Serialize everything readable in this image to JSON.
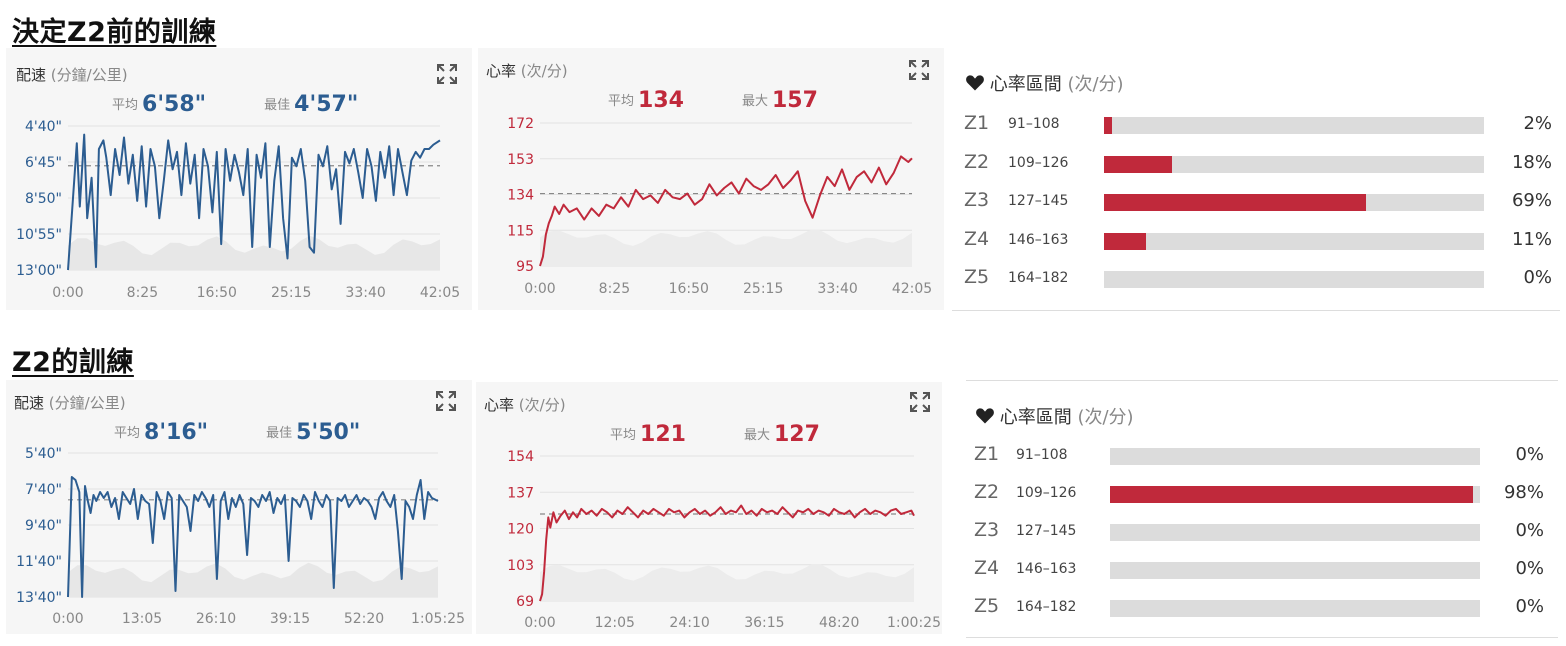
{
  "sections": [
    {
      "title": "決定Z2前的訓練",
      "pace": {
        "label": "配速",
        "unit": "(分鐘/公里)",
        "avg_label": "平均",
        "avg": "6'58\"",
        "best_label": "最佳",
        "best": "4'57\""
      },
      "hr": {
        "label": "心率",
        "unit": "(次/分)",
        "avg_label": "平均",
        "avg": "134",
        "max_label": "最大",
        "max": "157"
      },
      "zones": {
        "icon": "heart-icon",
        "label": "心率區間",
        "unit": "(次/分)",
        "items": [
          {
            "name": "Z1",
            "range": "91–108",
            "pct_text": "2%",
            "pct": 2
          },
          {
            "name": "Z2",
            "range": "109–126",
            "pct_text": "18%",
            "pct": 18
          },
          {
            "name": "Z3",
            "range": "127–145",
            "pct_text": "69%",
            "pct": 69
          },
          {
            "name": "Z4",
            "range": "146–163",
            "pct_text": "11%",
            "pct": 11
          },
          {
            "name": "Z5",
            "range": "164–182",
            "pct_text": "0%",
            "pct": 0
          }
        ]
      }
    },
    {
      "title": "Z2的訓練",
      "pace": {
        "label": "配速",
        "unit": "(分鐘/公里)",
        "avg_label": "平均",
        "avg": "8'16\"",
        "best_label": "最佳",
        "best": "5'50\""
      },
      "hr": {
        "label": "心率",
        "unit": "(次/分)",
        "avg_label": "平均",
        "avg": "121",
        "max_label": "最大",
        "max": "127"
      },
      "zones": {
        "icon": "heart-icon",
        "label": "心率區間",
        "unit": "(次/分)",
        "items": [
          {
            "name": "Z1",
            "range": "91–108",
            "pct_text": "0%",
            "pct": 0
          },
          {
            "name": "Z2",
            "range": "109–126",
            "pct_text": "98%",
            "pct": 98
          },
          {
            "name": "Z3",
            "range": "127–145",
            "pct_text": "0%",
            "pct": 0
          },
          {
            "name": "Z4",
            "range": "146–163",
            "pct_text": "0%",
            "pct": 0
          },
          {
            "name": "Z5",
            "range": "164–182",
            "pct_text": "0%",
            "pct": 0
          }
        ]
      }
    }
  ],
  "chart_data": [
    {
      "type": "line",
      "id": "pace1",
      "color": "#2c5d91",
      "yticks": [
        "4'40\"",
        "6'45\"",
        "8'50\"",
        "10'55\"",
        "13'00\""
      ],
      "ylim_seconds": [
        280,
        780
      ],
      "inverted": true,
      "xticks": [
        "0:00",
        "8:25",
        "16:50",
        "25:15",
        "33:40",
        "42:05"
      ],
      "xlim_seconds": [
        0,
        2525
      ],
      "avg_seconds": 418,
      "series": [
        {
          "x": [
            0,
            60,
            80,
            110,
            130,
            160,
            190,
            210,
            240,
            260,
            290,
            320,
            350,
            380,
            410,
            440,
            470,
            500,
            530,
            560,
            590,
            620,
            650,
            680,
            710,
            740,
            770,
            800,
            830,
            860,
            890,
            920,
            950,
            980,
            1010,
            1040,
            1070,
            1100,
            1130,
            1160,
            1190,
            1220,
            1250,
            1280,
            1310,
            1340,
            1370,
            1400,
            1430,
            1460,
            1490,
            1520,
            1550,
            1580,
            1610,
            1640,
            1670,
            1700,
            1730,
            1760,
            1790,
            1820,
            1850,
            1880,
            1910,
            1940,
            1970,
            2000,
            2030,
            2060,
            2090,
            2120,
            2150,
            2180,
            2210,
            2240,
            2270,
            2300,
            2330,
            2360,
            2390,
            2420,
            2450,
            2480,
            2525
          ],
          "y": [
            780,
            340,
            560,
            310,
            600,
            460,
            770,
            360,
            330,
            390,
            520,
            360,
            450,
            320,
            480,
            380,
            540,
            350,
            560,
            360,
            420,
            600,
            470,
            330,
            430,
            370,
            520,
            340,
            480,
            380,
            600,
            360,
            420,
            580,
            370,
            690,
            360,
            470,
            380,
            440,
            520,
            360,
            700,
            380,
            460,
            340,
            700,
            470,
            350,
            600,
            740,
            390,
            420,
            360,
            470,
            700,
            720,
            380,
            420,
            350,
            500,
            430,
            620,
            370,
            410,
            360,
            440,
            530,
            360,
            420,
            540,
            370,
            460,
            350,
            520,
            360,
            440,
            520,
            400,
            370,
            390,
            360,
            360,
            345,
            330
          ]
        }
      ]
    },
    {
      "type": "line",
      "id": "hr1",
      "color": "#c0293b",
      "yticks": [
        "172",
        "153",
        "134",
        "115",
        "95"
      ],
      "ylim": [
        95,
        172
      ],
      "xticks": [
        "0:00",
        "8:25",
        "16:50",
        "25:15",
        "33:40",
        "42:05"
      ],
      "xlim_seconds": [
        0,
        2525
      ],
      "avg": 134,
      "series": [
        {
          "x": [
            0,
            20,
            40,
            60,
            80,
            100,
            130,
            160,
            200,
            250,
            300,
            350,
            400,
            450,
            500,
            550,
            600,
            650,
            700,
            750,
            800,
            850,
            900,
            950,
            1000,
            1050,
            1100,
            1150,
            1200,
            1250,
            1300,
            1350,
            1400,
            1450,
            1500,
            1550,
            1600,
            1650,
            1700,
            1750,
            1800,
            1850,
            1900,
            1950,
            2000,
            2050,
            2100,
            2150,
            2200,
            2250,
            2300,
            2350,
            2400,
            2450,
            2500,
            2525
          ],
          "y": [
            95,
            100,
            112,
            118,
            122,
            127,
            123,
            128,
            124,
            126,
            120,
            126,
            122,
            128,
            126,
            132,
            127,
            136,
            131,
            133,
            129,
            136,
            132,
            131,
            134,
            128,
            131,
            139,
            133,
            137,
            140,
            134,
            142,
            138,
            136,
            139,
            144,
            137,
            141,
            146,
            130,
            121,
            133,
            143,
            138,
            147,
            136,
            143,
            146,
            140,
            148,
            139,
            145,
            154,
            151,
            153
          ]
        }
      ]
    },
    {
      "type": "line",
      "id": "pace2",
      "color": "#2c5d91",
      "yticks": [
        "5'40\"",
        "7'40\"",
        "9'40\"",
        "11'40\"",
        "13'40\""
      ],
      "ylim_seconds": [
        340,
        820
      ],
      "inverted": true,
      "xticks": [
        "0:00",
        "13:05",
        "26:10",
        "39:15",
        "52:20",
        "1:05:25"
      ],
      "xlim_seconds": [
        0,
        3925
      ],
      "avg_seconds": 496,
      "series": [
        {
          "x": [
            0,
            40,
            80,
            120,
            150,
            180,
            210,
            240,
            270,
            300,
            340,
            380,
            420,
            460,
            500,
            540,
            580,
            620,
            660,
            700,
            740,
            780,
            820,
            860,
            900,
            940,
            980,
            1020,
            1060,
            1100,
            1140,
            1180,
            1220,
            1260,
            1300,
            1340,
            1380,
            1420,
            1460,
            1500,
            1540,
            1580,
            1620,
            1660,
            1700,
            1740,
            1780,
            1820,
            1860,
            1900,
            1940,
            1980,
            2020,
            2060,
            2100,
            2140,
            2180,
            2220,
            2260,
            2300,
            2340,
            2380,
            2420,
            2460,
            2500,
            2540,
            2580,
            2620,
            2660,
            2700,
            2740,
            2780,
            2820,
            2860,
            2900,
            2940,
            2980,
            3020,
            3060,
            3100,
            3140,
            3180,
            3220,
            3260,
            3300,
            3340,
            3380,
            3420,
            3460,
            3500,
            3540,
            3580,
            3620,
            3660,
            3700,
            3740,
            3780,
            3820,
            3860,
            3925
          ],
          "y": [
            820,
            420,
            430,
            470,
            820,
            450,
            500,
            540,
            480,
            500,
            470,
            490,
            470,
            520,
            490,
            560,
            470,
            490,
            510,
            460,
            560,
            480,
            500,
            510,
            640,
            470,
            500,
            560,
            470,
            490,
            800,
            480,
            500,
            520,
            600,
            480,
            500,
            470,
            490,
            520,
            480,
            760,
            500,
            470,
            560,
            490,
            520,
            480,
            510,
            680,
            490,
            500,
            520,
            480,
            500,
            470,
            540,
            490,
            510,
            480,
            700,
            490,
            500,
            520,
            480,
            500,
            560,
            470,
            500,
            520,
            480,
            500,
            790,
            490,
            500,
            480,
            520,
            500,
            480,
            510,
            490,
            500,
            520,
            560,
            490,
            470,
            500,
            520,
            480,
            600,
            760,
            500,
            520,
            560,
            480,
            430,
            560,
            470,
            490,
            500
          ]
        }
      ]
    },
    {
      "type": "line",
      "id": "hr2",
      "color": "#c0293b",
      "yticks": [
        "154",
        "137",
        "120",
        "103",
        "69"
      ],
      "ylim": [
        69,
        154
      ],
      "xticks": [
        "0:00",
        "12:05",
        "24:10",
        "36:15",
        "48:20",
        "1:00:25"
      ],
      "xlim_seconds": [
        0,
        3625
      ],
      "avg": 120,
      "series": [
        {
          "x": [
            0,
            20,
            40,
            60,
            80,
            100,
            130,
            160,
            200,
            240,
            280,
            320,
            360,
            400,
            450,
            500,
            550,
            600,
            650,
            700,
            750,
            800,
            850,
            900,
            950,
            1000,
            1050,
            1100,
            1150,
            1200,
            1250,
            1300,
            1350,
            1400,
            1450,
            1500,
            1550,
            1600,
            1650,
            1700,
            1750,
            1800,
            1850,
            1900,
            1950,
            2000,
            2050,
            2100,
            2150,
            2200,
            2250,
            2300,
            2350,
            2400,
            2450,
            2500,
            2550,
            2600,
            2650,
            2700,
            2750,
            2800,
            2850,
            2900,
            2950,
            3000,
            3050,
            3100,
            3150,
            3200,
            3250,
            3300,
            3350,
            3400,
            3450,
            3500,
            3550,
            3600,
            3625
          ],
          "y": [
            69,
            73,
            86,
            105,
            118,
            112,
            121,
            115,
            119,
            122,
            117,
            121,
            118,
            123,
            120,
            122,
            119,
            123,
            121,
            118,
            122,
            120,
            124,
            121,
            118,
            122,
            120,
            123,
            121,
            119,
            123,
            121,
            122,
            118,
            121,
            123,
            120,
            122,
            119,
            121,
            124,
            120,
            122,
            121,
            125,
            120,
            122,
            119,
            123,
            121,
            122,
            120,
            124,
            121,
            118,
            122,
            121,
            123,
            120,
            122,
            121,
            119,
            123,
            121,
            120,
            122,
            118,
            121,
            123,
            120,
            122,
            121,
            119,
            122,
            123,
            120,
            121,
            122,
            119
          ]
        }
      ]
    }
  ]
}
